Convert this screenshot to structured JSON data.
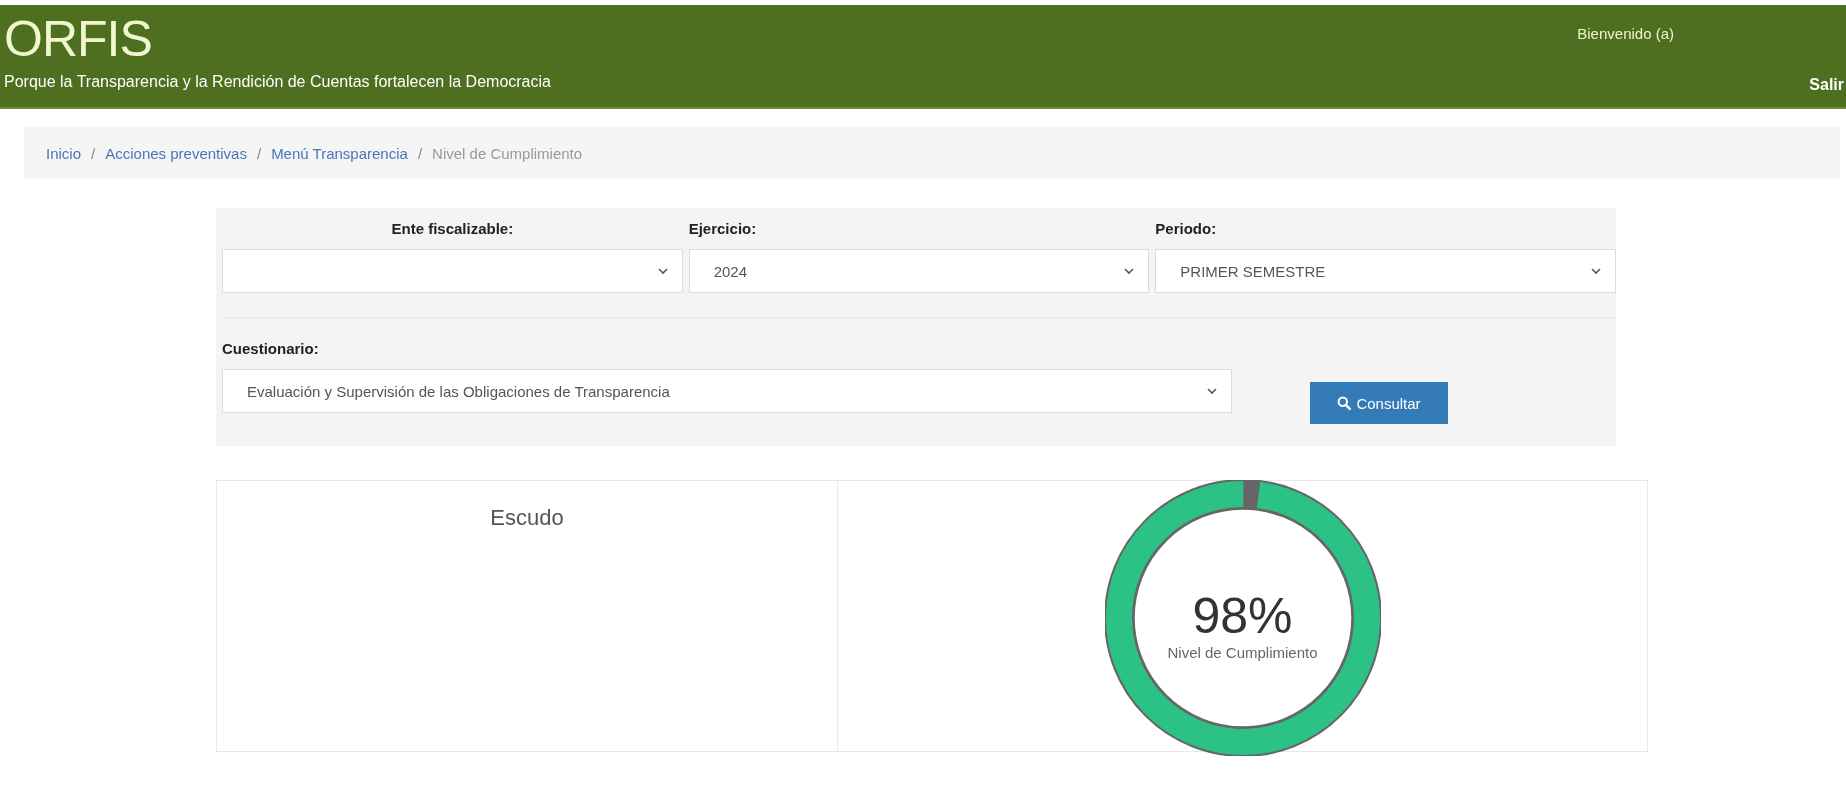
{
  "header": {
    "logo": "ORFIS",
    "tagline": "Porque la Transparencia y la Rendición de Cuentas fortalecen la Democracia",
    "welcome": "Bienvenido (a)",
    "logout": "Salir"
  },
  "breadcrumb": [
    {
      "label": "Inicio",
      "kind": "link"
    },
    {
      "label": "Acciones preventivas",
      "kind": "link",
      "separator": "/"
    },
    {
      "label": "Menú Transparencia",
      "kind": "link",
      "separator": "/"
    },
    {
      "label": "Nivel de Cumplimiento",
      "kind": "current",
      "separator": "/"
    }
  ],
  "filters": [
    {
      "label": "Ente fiscalizable:"
    },
    {
      "label": "Ejercicio:",
      "value": "2024"
    },
    {
      "label": "Periodo:",
      "value": "PRIMER SEMESTRE"
    }
  ],
  "questionnaire": {
    "label": "Cuestionario:",
    "value": "Evaluación y Supervisión de las Obligaciones de Transparencia"
  },
  "consult_button": "Consultar",
  "shield": {
    "title": "Escudo"
  },
  "gauge": {
    "value": "98%",
    "caption": "Nivel de Cumplimiento",
    "level": 0.98
  }
}
